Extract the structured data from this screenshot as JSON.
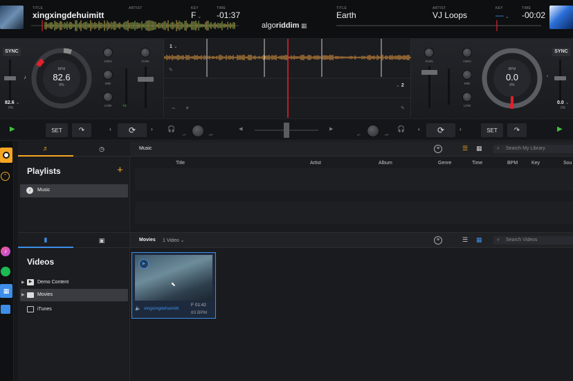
{
  "deck_left": {
    "title_label": "TITLE",
    "artist_label": "ARTIST",
    "key_label": "KEY",
    "time_label": "TIME",
    "title": "xingxingdehuimitt",
    "key": "F",
    "time": "-01:37",
    "sync": "SYNC",
    "bpm_label": "BPM",
    "bpm": "82.6",
    "pitch": "0%",
    "tempo_value": "82.6",
    "tempo_pct": "0%",
    "knob_high": "HIGH",
    "knob_mid": "MID",
    "knob_low": "LOW",
    "knob_gain": "GAIN",
    "gain_value": "+2",
    "deck_number": "1"
  },
  "deck_right": {
    "title_label": "TITLE",
    "artist_label": "ARTIST",
    "key_label": "KEY",
    "time_label": "TIME",
    "title": "Earth",
    "artist": "VJ Loops",
    "key": "—",
    "time": "-00:02",
    "sync": "SYNC",
    "bpm_label": "BPM",
    "bpm": "0.0",
    "pitch": "0%",
    "tempo_value": "0.0",
    "tempo_pct": "0%",
    "knob_high": "HIGH",
    "knob_mid": "MID",
    "knob_low": "LOW",
    "knob_gain": "GAIN",
    "deck_number": "2"
  },
  "logo": {
    "part1": "algo",
    "part2": "riddim"
  },
  "transport": {
    "set_label": "SET",
    "lp": "LP",
    "hp": "HP"
  },
  "music_panel": {
    "title": "Playlists",
    "header": "Music",
    "search_placeholder": "Search My Library",
    "playlists": [
      "Music"
    ],
    "columns": [
      "Title",
      "Artist",
      "Album",
      "Genre",
      "Time",
      "BPM",
      "Key",
      "Sou"
    ]
  },
  "video_panel": {
    "title": "Videos",
    "header": "Movies",
    "count": "1 Video",
    "search_placeholder": "Search Videos",
    "folders": [
      "Demo Content",
      "Movies",
      "iTunes"
    ],
    "video": {
      "title": "xingxingdehuimitt",
      "key_time": "F 01:42",
      "bpm": "83 BPM"
    }
  },
  "colors": {
    "accent_orange": "#f5a623",
    "accent_blue": "#3d8ee8",
    "playhead_red": "#e0202e",
    "play_green": "#3dc23d"
  }
}
